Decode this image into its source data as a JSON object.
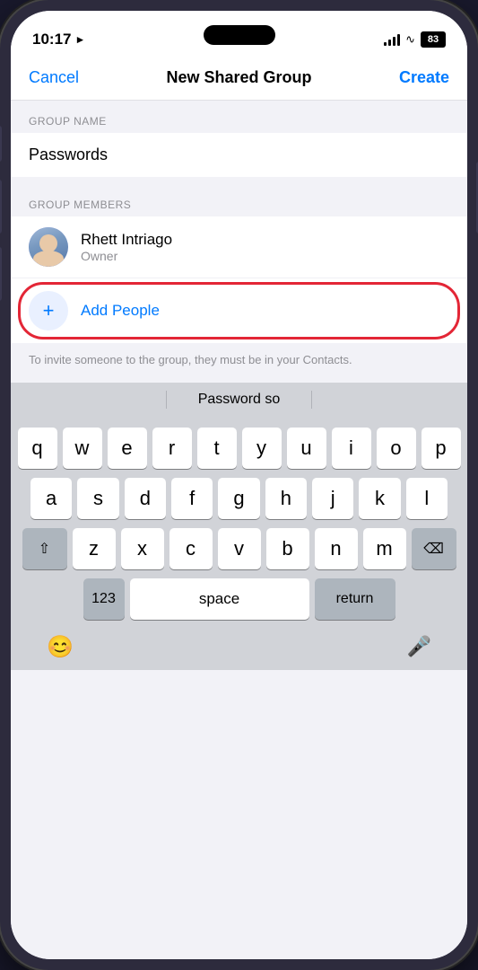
{
  "status_bar": {
    "time": "10:17",
    "location_icon": "▶",
    "battery": "83"
  },
  "nav": {
    "cancel_label": "Cancel",
    "title": "New Shared Group",
    "create_label": "Create"
  },
  "group_name_section": {
    "label": "GROUP NAME",
    "value": "Passwords"
  },
  "group_members_section": {
    "label": "GROUP MEMBERS",
    "members": [
      {
        "name": "Rhett Intriago",
        "role": "Owner"
      }
    ]
  },
  "add_people": {
    "label": "Add People",
    "plus": "+"
  },
  "invite_hint": {
    "text": "To invite someone to the group, they must be in your Contacts."
  },
  "keyboard": {
    "suggestion": "Password so",
    "rows": [
      [
        "q",
        "w",
        "e",
        "r",
        "t",
        "y",
        "u",
        "i",
        "o",
        "p"
      ],
      [
        "a",
        "s",
        "d",
        "f",
        "g",
        "h",
        "j",
        "k",
        "l"
      ],
      [
        "z",
        "x",
        "c",
        "v",
        "b",
        "n",
        "m"
      ],
      [
        "123",
        "space",
        "return"
      ]
    ]
  },
  "bottom": {
    "emoji_icon": "😊",
    "mic_icon": "🎤"
  }
}
